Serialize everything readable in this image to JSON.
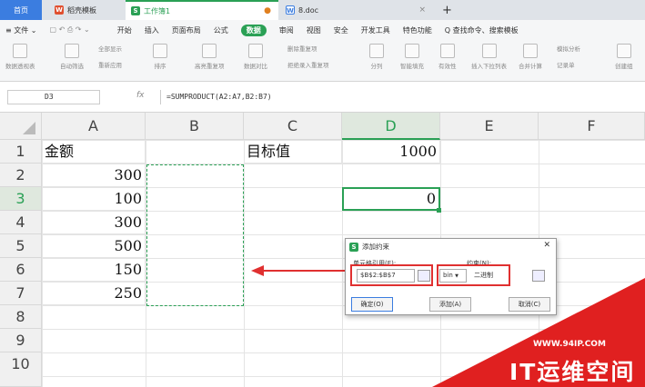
{
  "tabs": {
    "home": "首页",
    "t1": "稻壳模板",
    "t2": "工作簿1",
    "t3": "8.doc",
    "add": "+"
  },
  "menu": [
    "≡ 文件 ⌄",
    "开始",
    "插入",
    "页面布局",
    "公式",
    "数据",
    "审阅",
    "视图",
    "安全",
    "开发工具",
    "特色功能",
    "Q 查找命令、搜索模板"
  ],
  "ribbon": [
    "数据透视表",
    "自动筛选",
    "全部显示",
    "重新应用",
    "排序",
    "高亮重复项",
    "数据对比",
    "删除重复项",
    "拒绝录入重复项",
    "分列",
    "智能填充",
    "有效性",
    "插入下拉列表",
    "合并计算",
    "模拟分析",
    "记录单",
    "创建组"
  ],
  "formula": {
    "cell": "D3",
    "fx": "fx",
    "text": "=SUMPRODUCT(A2:A7,B2:B7)"
  },
  "columns": [
    "A",
    "B",
    "C",
    "D",
    "E",
    "F"
  ],
  "rows": [
    "1",
    "2",
    "3",
    "4",
    "5",
    "6",
    "7",
    "8",
    "9",
    "10"
  ],
  "cells": {
    "A1": "金额",
    "C1": "目标值",
    "D1": "1000",
    "A2": "300",
    "A3": "100",
    "A4": "300",
    "A5": "500",
    "A6": "150",
    "A7": "250",
    "D3": "0"
  },
  "dialog": {
    "title": "添加约束",
    "close": "✕",
    "ref_label": "单元格引用(E):",
    "con_label": "约束(N):",
    "ref": "$B$2:$B$7",
    "op": "bin",
    "op_arrow": "▼",
    "con": "二进制",
    "ok": "确定(O)",
    "add": "添加(A)",
    "cancel": "取消(C)"
  },
  "watermark": {
    "url": "WWW.94IP.COM",
    "name": "IT运维空间"
  },
  "colors": {
    "accent": "#2aa055",
    "red": "#e03030"
  }
}
